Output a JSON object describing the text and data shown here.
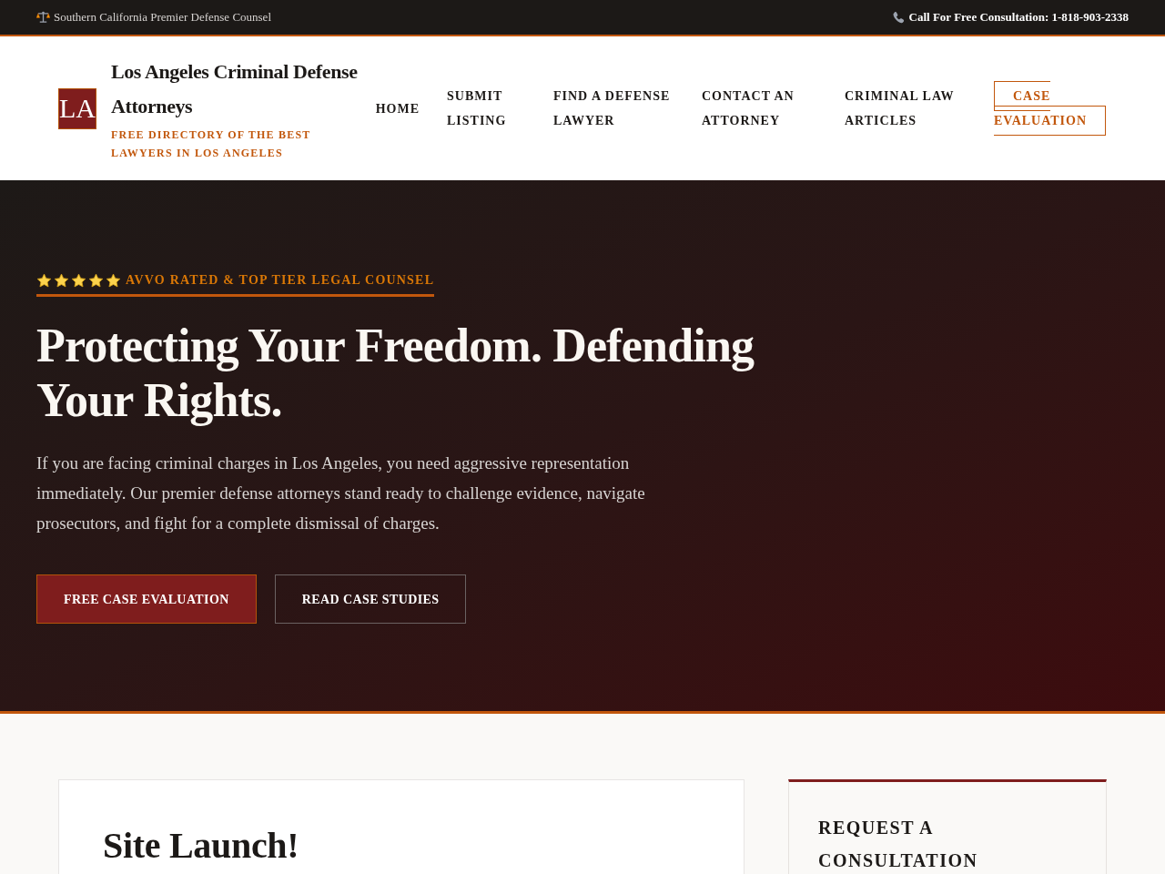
{
  "top_bar": {
    "tagline": "Southern California Premier Defense Counsel",
    "phone_cta": "Call For Free Consultation: 1-818-903-2338"
  },
  "header": {
    "logo_mark": "LA",
    "site_title": "Los Angeles Criminal Defense Attorneys",
    "tagline": "FREE DIRECTORY OF THE BEST LAWYERS IN LOS ANGELES",
    "nav": [
      {
        "label": "HOME",
        "kind": "link"
      },
      {
        "label": "SUBMIT LISTING",
        "kind": "link"
      },
      {
        "label": "FIND A DEFENSE LAWYER",
        "kind": "link"
      },
      {
        "label": "CONTACT AN ATTORNEY",
        "kind": "link"
      },
      {
        "label": "CRIMINAL LAW ARTICLES",
        "kind": "link"
      },
      {
        "label": "CASE EVALUATION",
        "kind": "outlined"
      }
    ]
  },
  "hero": {
    "badge": {
      "stars": 5,
      "text": "AVVO RATED & TOP TIER LEGAL COUNSEL"
    },
    "heading": "Protecting Your Freedom. Defending Your Rights.",
    "body": "If you are facing criminal charges in Los Angeles, you need aggressive representation immediately. Our premier defense attorneys stand ready to challenge evidence, navigate prosecutors, and fight for a complete dismissal of charges.",
    "buttons": [
      {
        "label": "FREE CASE EVALUATION",
        "kind": "primary"
      },
      {
        "label": "READ CASE STUDIES",
        "kind": "outline"
      }
    ]
  },
  "main": {
    "post": {
      "title": "Site Launch!"
    },
    "sidebar": {
      "title": "REQUEST A CONSULTATION"
    }
  }
}
